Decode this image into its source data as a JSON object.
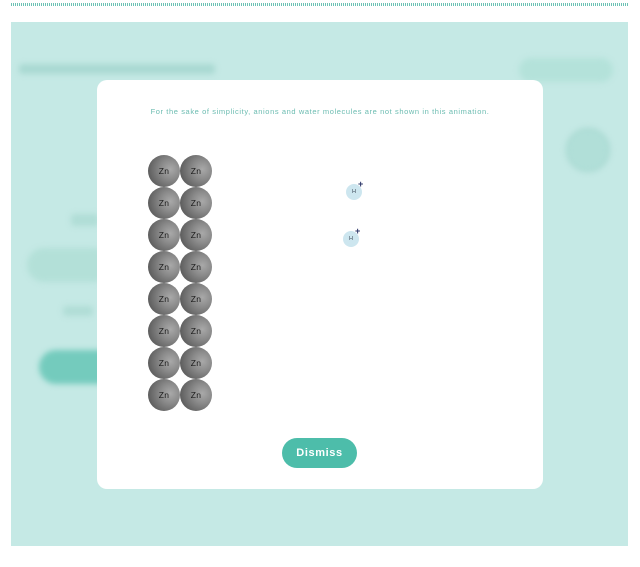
{
  "modal": {
    "note": "For the sake of simplicity, anions and water molecules are not shown in this animation.",
    "dismiss_label": "Dismiss"
  },
  "zinc_atoms": {
    "label": "Zn",
    "columns": 2,
    "rows": 8
  },
  "hydrogen_ions": [
    {
      "label": "H",
      "charge": "+"
    },
    {
      "label": "H",
      "charge": "+"
    }
  ],
  "colors": {
    "accent": "#4dbdaa",
    "backdrop": "#c5e9e5",
    "note_text": "#6cbcb1",
    "ion_fill": "#cde6ef"
  }
}
